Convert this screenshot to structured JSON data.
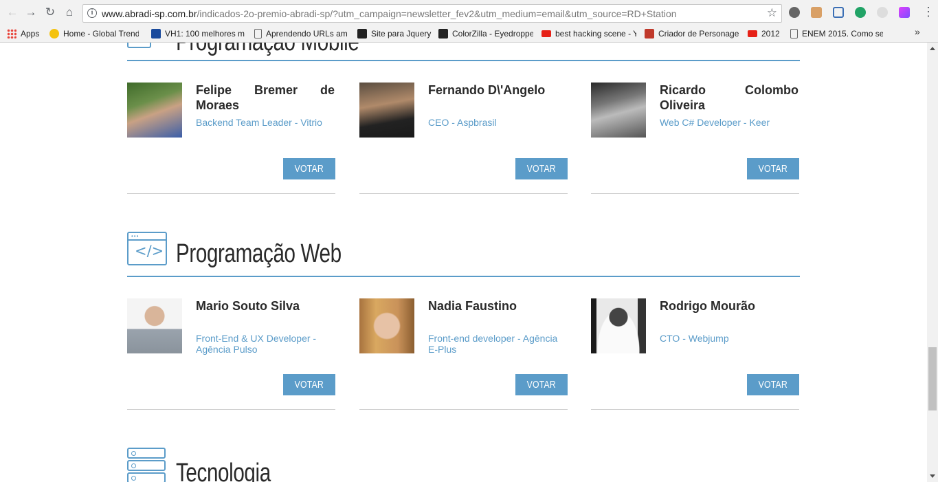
{
  "browser": {
    "url_host": "www.abradi-sp.com.br",
    "url_path": "/indicados-2o-premio-abradi-sp/?utm_campaign=newsletter_fev2&utm_medium=email&utm_source=RD+Station",
    "bookmarks": [
      {
        "label": "Apps",
        "icon": "apps-grid-icon",
        "color": "#e8453c"
      },
      {
        "label": "Home - Global Trend",
        "icon": "globe-icon",
        "color": "#f4c20d"
      },
      {
        "label": "VH1: 100 melhores m",
        "icon": "vh1-icon",
        "color": "#1a4a9c"
      },
      {
        "label": "Aprendendo URLs am",
        "icon": "page-icon",
        "color": "#ffffff"
      },
      {
        "label": "Site para Jquery",
        "icon": "ip-icon",
        "color": "#222222"
      },
      {
        "label": "ColorZilla - Eyedroppe",
        "icon": "ip-icon",
        "color": "#222222"
      },
      {
        "label": "best hacking scene - Y",
        "icon": "youtube-icon",
        "color": "#e62117"
      },
      {
        "label": "Criador de Personage",
        "icon": "site-icon",
        "color": "#c0392b"
      },
      {
        "label": "2012",
        "icon": "youtube-icon",
        "color": "#e62117"
      },
      {
        "label": "ENEM 2015. Como se",
        "icon": "page-icon",
        "color": "#ffffff"
      }
    ]
  },
  "accent_color": "#5b9cc9",
  "sections": [
    {
      "title": "Programação Mobile",
      "cards": [
        {
          "name": "Felipe Bremer de Moraes",
          "role": "Backend Team Leader - Vitrio",
          "vote": "VOTAR"
        },
        {
          "name": "Fernando D\\'Angelo",
          "role": "CEO - Aspbrasil",
          "vote": "VOTAR"
        },
        {
          "name": "Ricardo Colombo Oliveira",
          "role": "Web C# Developer - Keer",
          "vote": "VOTAR"
        }
      ]
    },
    {
      "title": "Programação Web",
      "cards": [
        {
          "name": "Mario Souto Silva",
          "role": "Front-End & UX Developer - Agência Pulso",
          "vote": "VOTAR"
        },
        {
          "name": "Nadia Faustino",
          "role": "Front-end developer - Agência E-Plus",
          "vote": "VOTAR"
        },
        {
          "name": "Rodrigo Mourão",
          "role": "CTO - Webjump",
          "vote": "VOTAR"
        }
      ]
    },
    {
      "title": "Tecnologia"
    }
  ]
}
